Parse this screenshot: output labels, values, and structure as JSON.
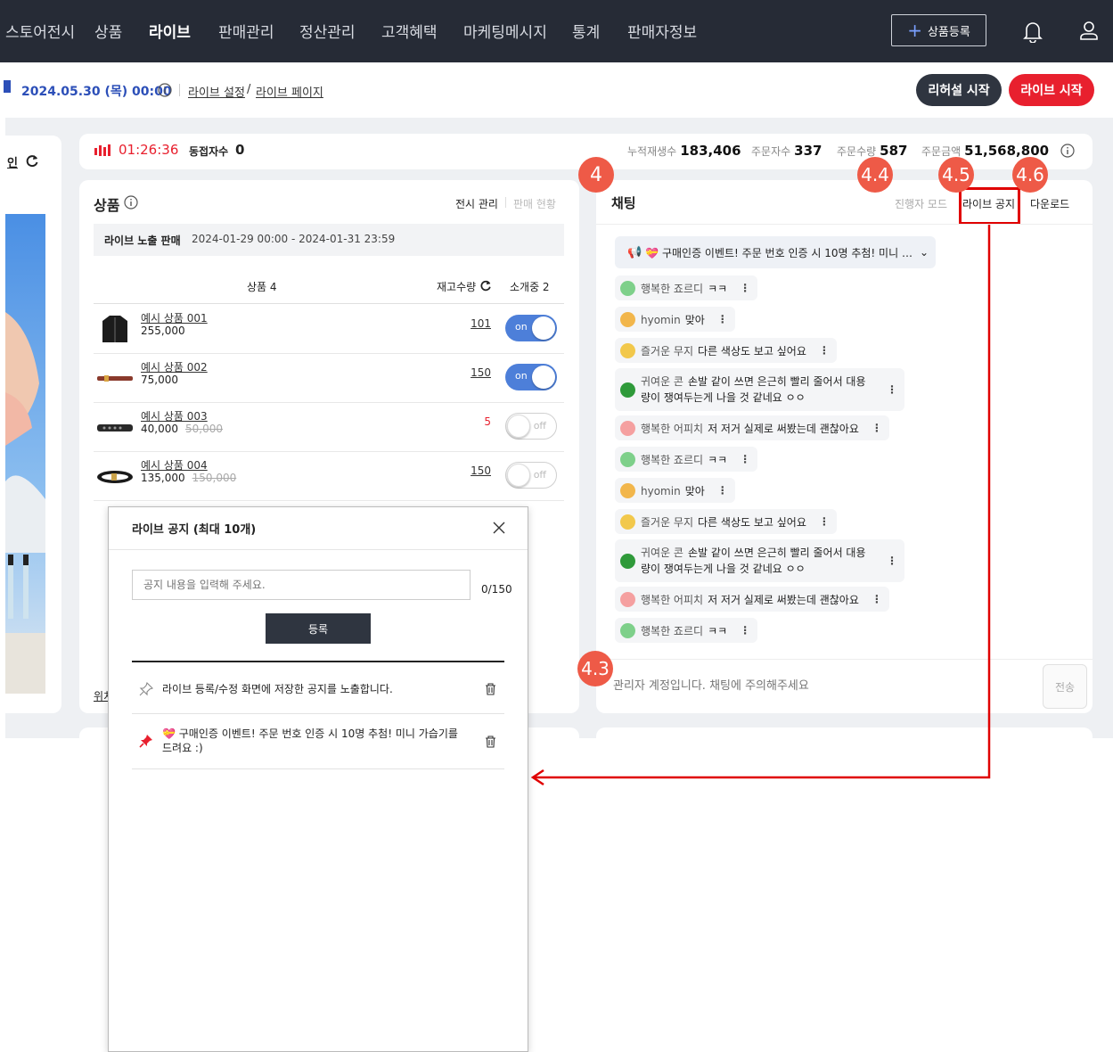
{
  "nav": {
    "items": [
      "스토어전시",
      "상품",
      "라이브",
      "판매관리",
      "정산관리",
      "고객혜택",
      "마케팅메시지",
      "통계",
      "판매자정보"
    ],
    "active": "라이브",
    "register_label": "상품등록"
  },
  "subbar": {
    "date": "2024.05.30 (목) 00:00",
    "link_settings": "라이브 설정",
    "link_sep": "/",
    "link_page": "라이브 페이지",
    "rehearsal_label": "리허설 시작",
    "live_label": "라이브 시작",
    "left_clip": "인"
  },
  "stats": {
    "timer": "01:26:36",
    "concurrent_label": "동접자수",
    "concurrent_value": "0",
    "plays_label": "누적재생수",
    "plays_value": "183,406",
    "buyers_label": "주문자수",
    "buyers_value": "337",
    "qty_label": "주문수량",
    "qty_value": "587",
    "amount_label": "주문금액",
    "amount_value": "51,568,800"
  },
  "products": {
    "title": "상품",
    "tab_display": "전시 관리",
    "tab_sales": "판매 현황",
    "sale_label": "라이브 노출 판매",
    "sale_period": "2024-01-29 00:00 - 2024-01-31 23:59",
    "col_products": "상품 4",
    "col_stock": "재고수량",
    "col_intro": "소개중 2",
    "left_bottom_clip": "위치",
    "rows": [
      {
        "name": "예시 상품 001",
        "price": "255,000",
        "orig": "",
        "stock": "101",
        "stock_red": false,
        "toggle": "on"
      },
      {
        "name": "예시 상품 002",
        "price": "75,000",
        "orig": "",
        "stock": "150",
        "stock_red": false,
        "toggle": "on"
      },
      {
        "name": "예시 상품 003",
        "price": "40,000",
        "orig": "50,000",
        "stock": "5",
        "stock_red": true,
        "toggle": "off"
      },
      {
        "name": "예시 상품 004",
        "price": "135,000",
        "orig": "150,000",
        "stock": "150",
        "stock_red": false,
        "toggle": "off"
      }
    ]
  },
  "chat": {
    "title": "채팅",
    "mode_label": "진행자 모드",
    "notice_label": "라이브 공지",
    "download_label": "다운로드",
    "pinned": "💝 구매인증 이벤트! 주문 번호 인증 시 10명 추첨! 미니 가···",
    "messages": [
      {
        "nick": "행복한 죠르디",
        "text": "ㅋㅋ",
        "color": "#7ed08a"
      },
      {
        "nick": "hyomin",
        "text": "맞아",
        "color": "#f2b64b"
      },
      {
        "nick": "즐거운 무지",
        "text": "다른 색상도 보고 싶어요",
        "color": "#f2c84b"
      },
      {
        "nick": "귀여운 콘",
        "text": "손발 같이 쓰면 은근히 빨리 줄어서 대용량이 쟁여두는게 나을 것 같네요 ㅇㅇ",
        "color": "#2f9a3a"
      },
      {
        "nick": "행복한 어피치",
        "text": "저 저거 실제로 써봤는데 괜찮아요",
        "color": "#f5a0a0"
      },
      {
        "nick": "행복한 죠르디",
        "text": "ㅋㅋ",
        "color": "#7ed08a"
      },
      {
        "nick": "hyomin",
        "text": "맞아",
        "color": "#f2b64b"
      },
      {
        "nick": "즐거운 무지",
        "text": "다른 색상도 보고 싶어요",
        "color": "#f2c84b"
      },
      {
        "nick": "귀여운 콘",
        "text": "손발 같이 쓰면 은근히 빨리 줄어서 대용량이 쟁여두는게 나을 것 같네요 ㅇㅇ",
        "color": "#2f9a3a"
      },
      {
        "nick": "행복한 어피치",
        "text": "저 저거 실제로 써봤는데 괜찮아요",
        "color": "#f5a0a0"
      },
      {
        "nick": "행복한 죠르디",
        "text": "ㅋㅋ",
        "color": "#7ed08a"
      }
    ],
    "input_placeholder": "관리자 계정입니다. 채팅에 주의해주세요",
    "send_label": "전송"
  },
  "badges": [
    "4",
    "4.4",
    "4.5",
    "4.6",
    "4.3"
  ],
  "modal": {
    "title": "라이브 공지 (최대 10개)",
    "input_placeholder": "공지 내용을 입력해 주세요.",
    "counter": "0/150",
    "submit_label": "등록",
    "notices": [
      {
        "text": "라이브 등록/수정 화면에 저장한 공지를 노출합니다.",
        "pinned": false
      },
      {
        "text": "💝 구매인증 이벤트! 주문 번호 인증 시 10명 추첨! 미니 가습기를 드려요 :)",
        "pinned": true
      }
    ]
  },
  "colors": {
    "nav_bg": "#262b36",
    "accent_red": "#e8202e",
    "badge": "#ee5a47",
    "highlight": "#e00000"
  }
}
